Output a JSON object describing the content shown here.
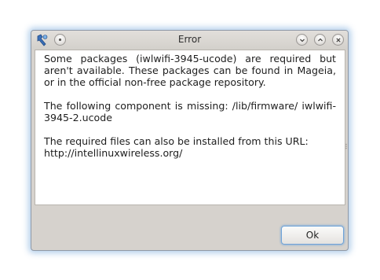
{
  "window": {
    "title": "Error"
  },
  "titlebar": {
    "app_icon": "mageia-wrench-icon",
    "buttons": [
      "pin-icon",
      "minimize-icon",
      "maximize-icon",
      "close-icon"
    ]
  },
  "message": {
    "paragraph1": "Some packages (iwlwifi-3945-ucode) are required but aren't available. These packages can be found in Mageia, or in the official non-free package repository.",
    "paragraph2": "The following component is missing: /lib/firmware/ iwlwifi-3945-2.ucode",
    "paragraph3": "The required files can also be installed from this URL:",
    "url": "http://intellinuxwireless.org/"
  },
  "buttons": {
    "ok_label": "Ok"
  },
  "colors": {
    "window_bg": "#d6d2cd",
    "focus_glow": "#5a96d2",
    "content_bg": "#ffffff"
  }
}
